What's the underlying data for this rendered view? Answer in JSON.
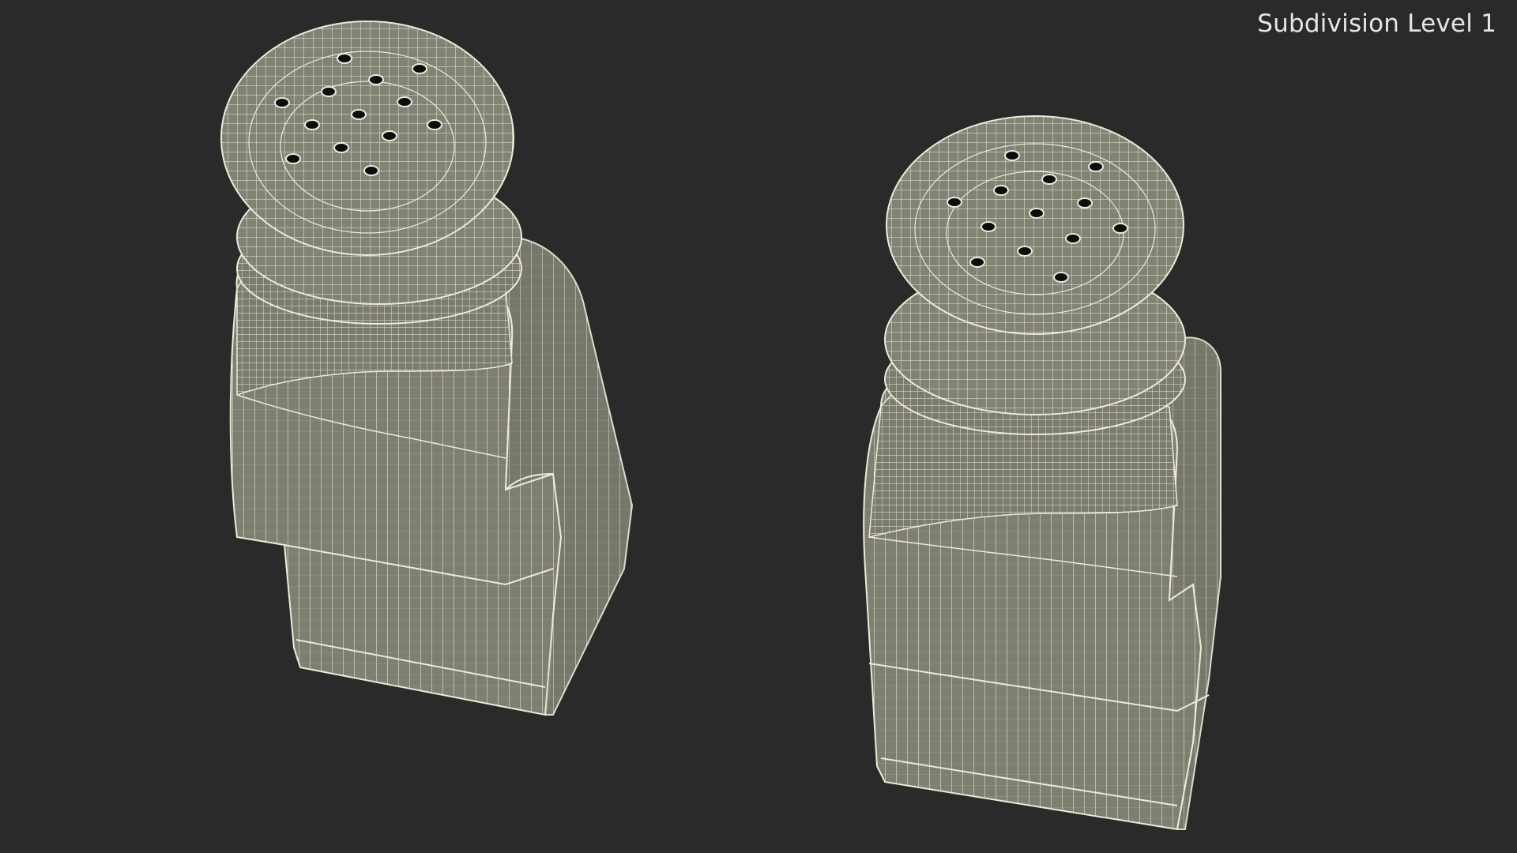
{
  "viewport": {
    "label": "Subdivision Level 1"
  },
  "colors": {
    "background": "#2a2a2a",
    "surface": "#7f8072",
    "surface_dark": "#6f7063",
    "wire": "#ecebd9",
    "hole": "#0d0d0d"
  },
  "objects": [
    {
      "name": "salt-shaker-left",
      "holes": 13
    },
    {
      "name": "salt-shaker-right",
      "holes": 13
    }
  ]
}
